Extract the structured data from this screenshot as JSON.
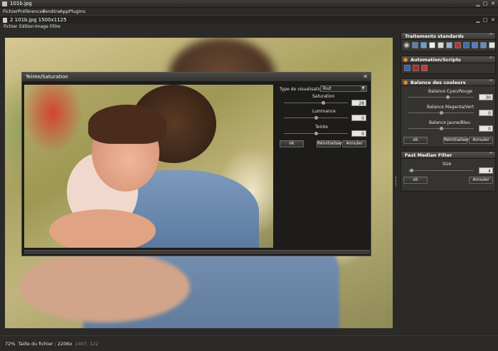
{
  "window": {
    "title": "101b.jpg",
    "controls": {
      "minimize": "▁",
      "maximize": "□",
      "close": "✕"
    }
  },
  "menubar": [
    "Fichier",
    "Préférences",
    "Fenêtre",
    "AppPlugins"
  ],
  "document": {
    "title": "2  101b.jpg   1500x1125",
    "menu": [
      "Fichier",
      "Edition",
      "Image",
      "Filtre"
    ]
  },
  "dialog": {
    "title": "Teinte/Saturation",
    "close_glyph": "✕",
    "view_type_label": "Type de visualisation :",
    "view_type_value": "Tout",
    "saturation": {
      "label": "Saturation",
      "value": "28",
      "level": 0.62
    },
    "luminance": {
      "label": "Luminance",
      "value": "0",
      "level": 0.5
    },
    "teinte": {
      "label": "Teinte",
      "value": "0",
      "level": 0.5
    },
    "ok": "ok",
    "reset": "Réinitialiser",
    "cancel": "Annuler"
  },
  "right_panel": {
    "standard": {
      "title": "Traitements standards",
      "collapse": "^",
      "tools": [
        "levels-icon",
        "select-icon",
        "fill-icon",
        "image-icon",
        "brush-icon",
        "layers-icon",
        "flag-icon",
        "undo-icon",
        "redo-icon",
        "swap-icon",
        "stack-icon"
      ]
    },
    "automation": {
      "title": "Automation/Scripts",
      "collapse": "^",
      "tools": [
        "help-icon",
        "record-icon",
        "stop-icon"
      ]
    },
    "balance": {
      "title": "Balance des couleurs",
      "collapse": "^",
      "cyan_red": {
        "label": "Balance Cyan/Rouge",
        "value": "30",
        "level": 0.6
      },
      "magenta_green": {
        "label": "Balance Magenta/Vert",
        "value": "0",
        "level": 0.5
      },
      "yellow_blue": {
        "label": "Balance Jaune/Bleu",
        "value": "0",
        "level": 0.5
      },
      "ok": "ok",
      "reset": "Réinitialiser",
      "cancel": "Annuler"
    },
    "median": {
      "title": "Fast Median Filter",
      "collapse": "^",
      "size": {
        "label": "Size",
        "value": "4",
        "level": 0.05
      },
      "ok": "ok",
      "cancel": "Annuler"
    }
  },
  "status": {
    "zoom": "72%",
    "file_size": "Taille du fichier : 220Ko",
    "coords": "1407, 122"
  },
  "colors": {
    "panel_bg": "#2b2a28",
    "header": "#3a3835",
    "accent_orange": "#e08a1c"
  }
}
